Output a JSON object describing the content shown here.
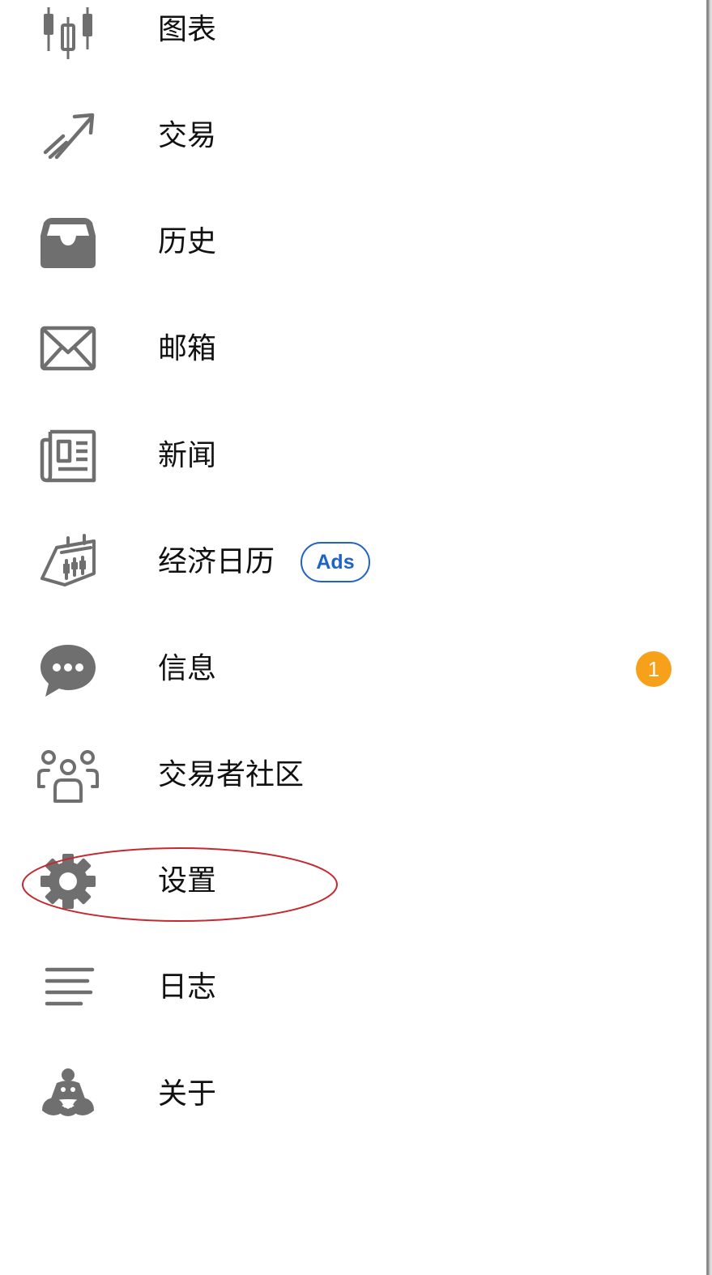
{
  "menu": {
    "items": [
      {
        "id": "charts",
        "label": "图表",
        "icon": "candlestick-icon"
      },
      {
        "id": "trade",
        "label": "交易",
        "icon": "trend-arrow-icon"
      },
      {
        "id": "history",
        "label": "历史",
        "icon": "inbox-tray-icon"
      },
      {
        "id": "mailbox",
        "label": "邮箱",
        "icon": "envelope-icon"
      },
      {
        "id": "news",
        "label": "新闻",
        "icon": "newspaper-icon"
      },
      {
        "id": "economic-calendar",
        "label": "经济日历",
        "icon": "calendar-icon",
        "chip": "Ads"
      },
      {
        "id": "messages",
        "label": "信息",
        "icon": "chat-bubble-icon",
        "badge": "1"
      },
      {
        "id": "traders-community",
        "label": "交易者社区",
        "icon": "community-icon"
      },
      {
        "id": "settings",
        "label": "设置",
        "icon": "gear-icon"
      },
      {
        "id": "journal",
        "label": "日志",
        "icon": "lines-icon"
      },
      {
        "id": "about",
        "label": "关于",
        "icon": "logo-icon"
      }
    ]
  },
  "colors": {
    "icon": "#6f6f6f",
    "label": "#111111",
    "ads_chip": "#1f63c6",
    "badge": "#f7a019",
    "annotation": "#c6282f"
  }
}
